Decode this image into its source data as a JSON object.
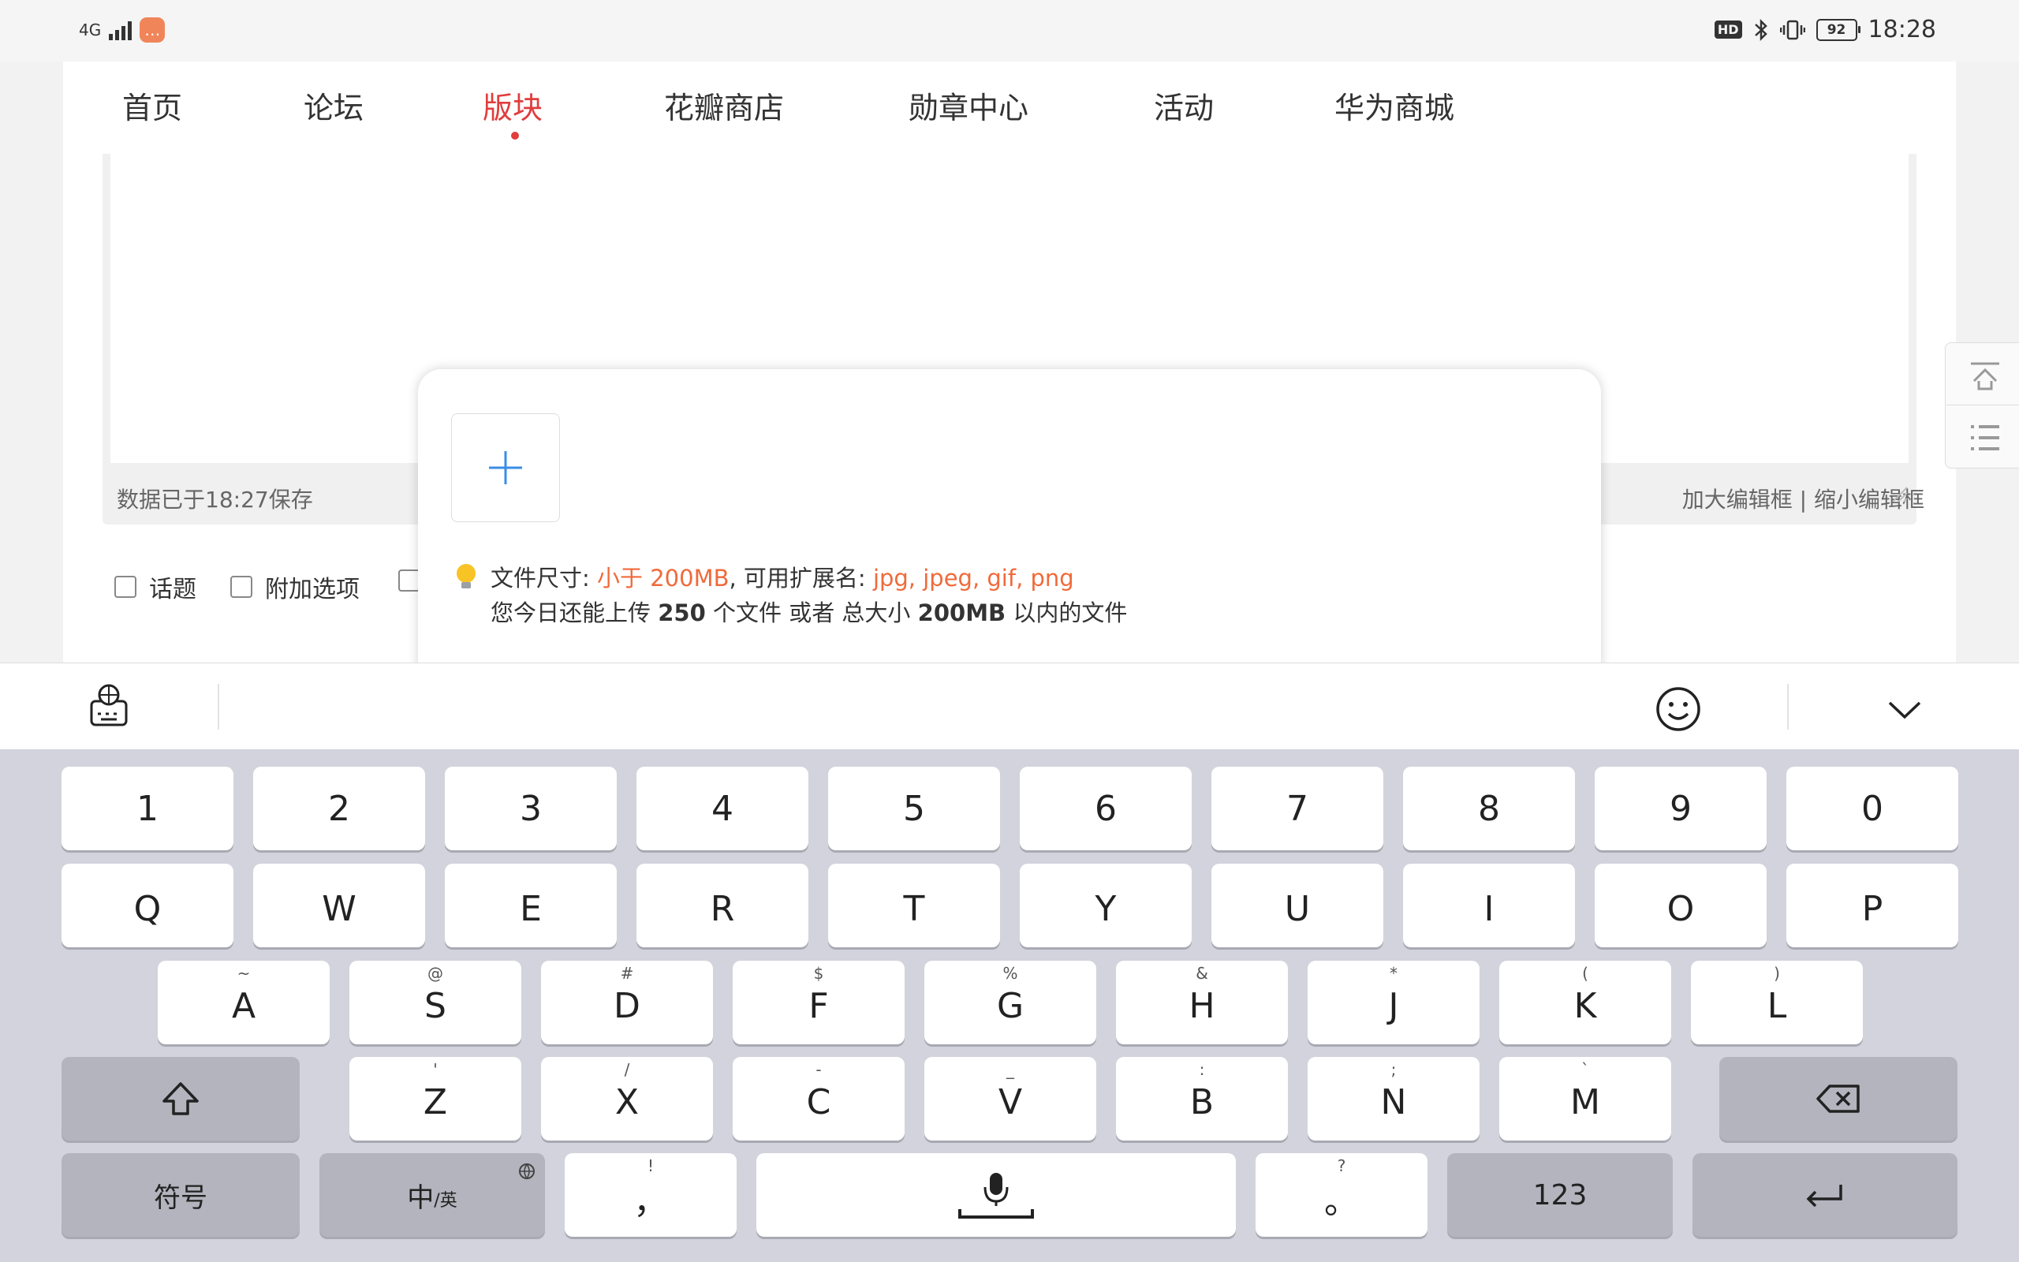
{
  "status_bar": {
    "network": "4G",
    "hd": "HD",
    "battery": "92",
    "time": "18:28"
  },
  "nav": {
    "items": [
      {
        "label": "首页"
      },
      {
        "label": "论坛"
      },
      {
        "label": "版块"
      },
      {
        "label": "花瓣商店"
      },
      {
        "label": "勋章中心"
      },
      {
        "label": "活动"
      },
      {
        "label": "华为商城"
      }
    ],
    "active_index": 2
  },
  "editor": {
    "save_status": "数据已于18:27保存",
    "enlarge": "加大编辑框",
    "separator": "|",
    "shrink": "缩小编辑框"
  },
  "options": [
    {
      "label": "话题"
    },
    {
      "label": "附加选项"
    }
  ],
  "upload_popup": {
    "size_label": "文件尺寸:",
    "size_value": "小于 200MB",
    "ext_label": ", 可用扩展名:",
    "ext_value": "jpg, jpeg, gif, png",
    "daily_prefix": "您今日还能上传",
    "daily_count": "250",
    "daily_mid": "个文件 或者 总大小",
    "daily_size": "200MB",
    "daily_suffix": "以内的文件"
  },
  "keyboard": {
    "numbers": [
      "1",
      "2",
      "3",
      "4",
      "5",
      "6",
      "7",
      "8",
      "9",
      "0"
    ],
    "row_q": [
      "Q",
      "W",
      "E",
      "R",
      "T",
      "Y",
      "U",
      "I",
      "O",
      "P"
    ],
    "row_a": [
      {
        "key": "A",
        "sub": "~"
      },
      {
        "key": "S",
        "sub": "@"
      },
      {
        "key": "D",
        "sub": "#"
      },
      {
        "key": "F",
        "sub": "$"
      },
      {
        "key": "G",
        "sub": "%"
      },
      {
        "key": "H",
        "sub": "&"
      },
      {
        "key": "J",
        "sub": "*"
      },
      {
        "key": "K",
        "sub": "("
      },
      {
        "key": "L",
        "sub": ")"
      }
    ],
    "row_z": [
      {
        "key": "Z",
        "sub": "'"
      },
      {
        "key": "X",
        "sub": "/"
      },
      {
        "key": "C",
        "sub": "-"
      },
      {
        "key": "V",
        "sub": "_"
      },
      {
        "key": "B",
        "sub": ":"
      },
      {
        "key": "N",
        "sub": ";"
      },
      {
        "key": "M",
        "sub": "`"
      }
    ],
    "symbols": "符号",
    "lang_main": "中",
    "lang_sub": "/英",
    "comma": "，",
    "comma_sub": "!",
    "period": "。",
    "period_sub": "?",
    "num_mode": "123"
  },
  "icons": {
    "shift": "shift-icon",
    "backspace": "backspace-icon",
    "enter": "enter-icon",
    "mic": "mic-icon",
    "globe": "globe-icon",
    "emoji": "emoji-icon",
    "collapse": "chevron-down-icon"
  }
}
